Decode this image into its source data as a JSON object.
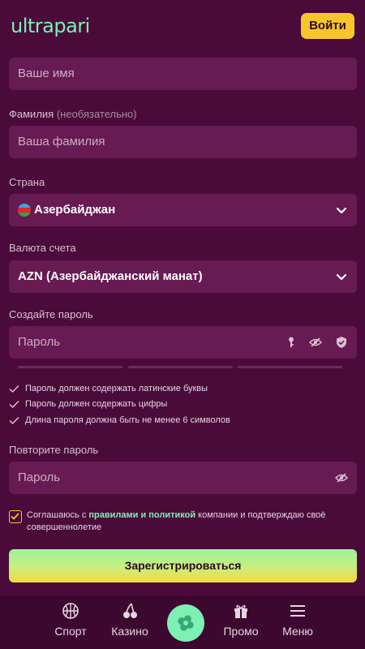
{
  "header": {
    "logo": "ultrapari",
    "login_label": "Войти"
  },
  "form": {
    "name_placeholder": "Ваше имя",
    "surname_label": "Фамилия",
    "surname_optional": "(необязательно)",
    "surname_placeholder": "Ваша фамилия",
    "country_label": "Страна",
    "country_value": "Азербайджан",
    "currency_label": "Валюта счета",
    "currency_value": "AZN (Азербайджанский манат)",
    "password_label": "Создайте пароль",
    "password_placeholder": "Пароль",
    "rules": [
      "Пароль должен содержать латинские буквы",
      "Пароль должен содержать цифры",
      "Длина пароля должна быть не менее 6 символов"
    ],
    "repeat_label": "Повторите пароль",
    "repeat_placeholder": "Пароль",
    "agree_prefix": "Соглашаюсь с ",
    "agree_link": "правилами и политикой",
    "agree_suffix": " компании и подтверждаю своё совершеннолетие",
    "agree_checked": true,
    "register_label": "Зарегистрироваться"
  },
  "bottom_nav": [
    {
      "label": "Спорт",
      "icon": "basketball-icon"
    },
    {
      "label": "Казино",
      "icon": "cherries-icon"
    },
    {
      "label": "",
      "icon": "clover-icon"
    },
    {
      "label": "Промо",
      "icon": "gift-icon"
    },
    {
      "label": "Меню",
      "icon": "hamburger-menu-icon"
    }
  ],
  "colors": {
    "background": "#4a0b3a",
    "field": "#681a52",
    "accent_green": "#7df0b4",
    "accent_yellow": "#f8c52a"
  }
}
